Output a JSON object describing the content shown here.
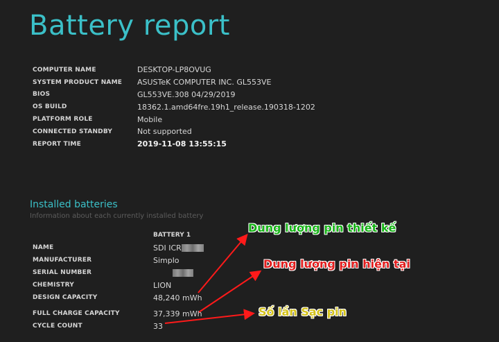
{
  "page_title": "Battery report",
  "system_info": [
    {
      "label": "COMPUTER NAME",
      "value": "DESKTOP-LP8OVUG"
    },
    {
      "label": "SYSTEM PRODUCT NAME",
      "value": "ASUSTeK COMPUTER INC. GL553VE"
    },
    {
      "label": "BIOS",
      "value": "GL553VE.308 04/29/2019"
    },
    {
      "label": "OS BUILD",
      "value": "18362.1.amd64fre.19h1_release.190318-1202"
    },
    {
      "label": "PLATFORM ROLE",
      "value": "Mobile"
    },
    {
      "label": "CONNECTED STANDBY",
      "value": "Not supported"
    },
    {
      "label": "REPORT TIME",
      "value": "2019-11-08  13:55:15"
    }
  ],
  "installed_batteries": {
    "title": "Installed batteries",
    "subtitle": "Information about each currently installed battery",
    "column_header": "BATTERY 1",
    "rows": [
      {
        "label": "NAME",
        "value": "SDI ICR"
      },
      {
        "label": "MANUFACTURER",
        "value": "Simplo"
      },
      {
        "label": "SERIAL NUMBER",
        "value": ""
      },
      {
        "label": "CHEMISTRY",
        "value": "LION"
      },
      {
        "label": "DESIGN CAPACITY",
        "value": "48,240 mWh"
      },
      {
        "label": "FULL CHARGE CAPACITY",
        "value": "37,339 mWh"
      },
      {
        "label": "CYCLE COUNT",
        "value": "33"
      }
    ]
  },
  "annotations": {
    "design_capacity": "Dung lượng pin thiết kế",
    "current_capacity": "Dung lượng pin hiện tại",
    "cycle_count": "Số lần Sạc pin"
  },
  "colors": {
    "background": "#1f1f1f",
    "accent": "#3bc0c8",
    "annotation_green": "#17b317",
    "annotation_red": "#e21d1d",
    "annotation_yellow": "#d4c21b",
    "arrow": "#ff1a1a"
  }
}
